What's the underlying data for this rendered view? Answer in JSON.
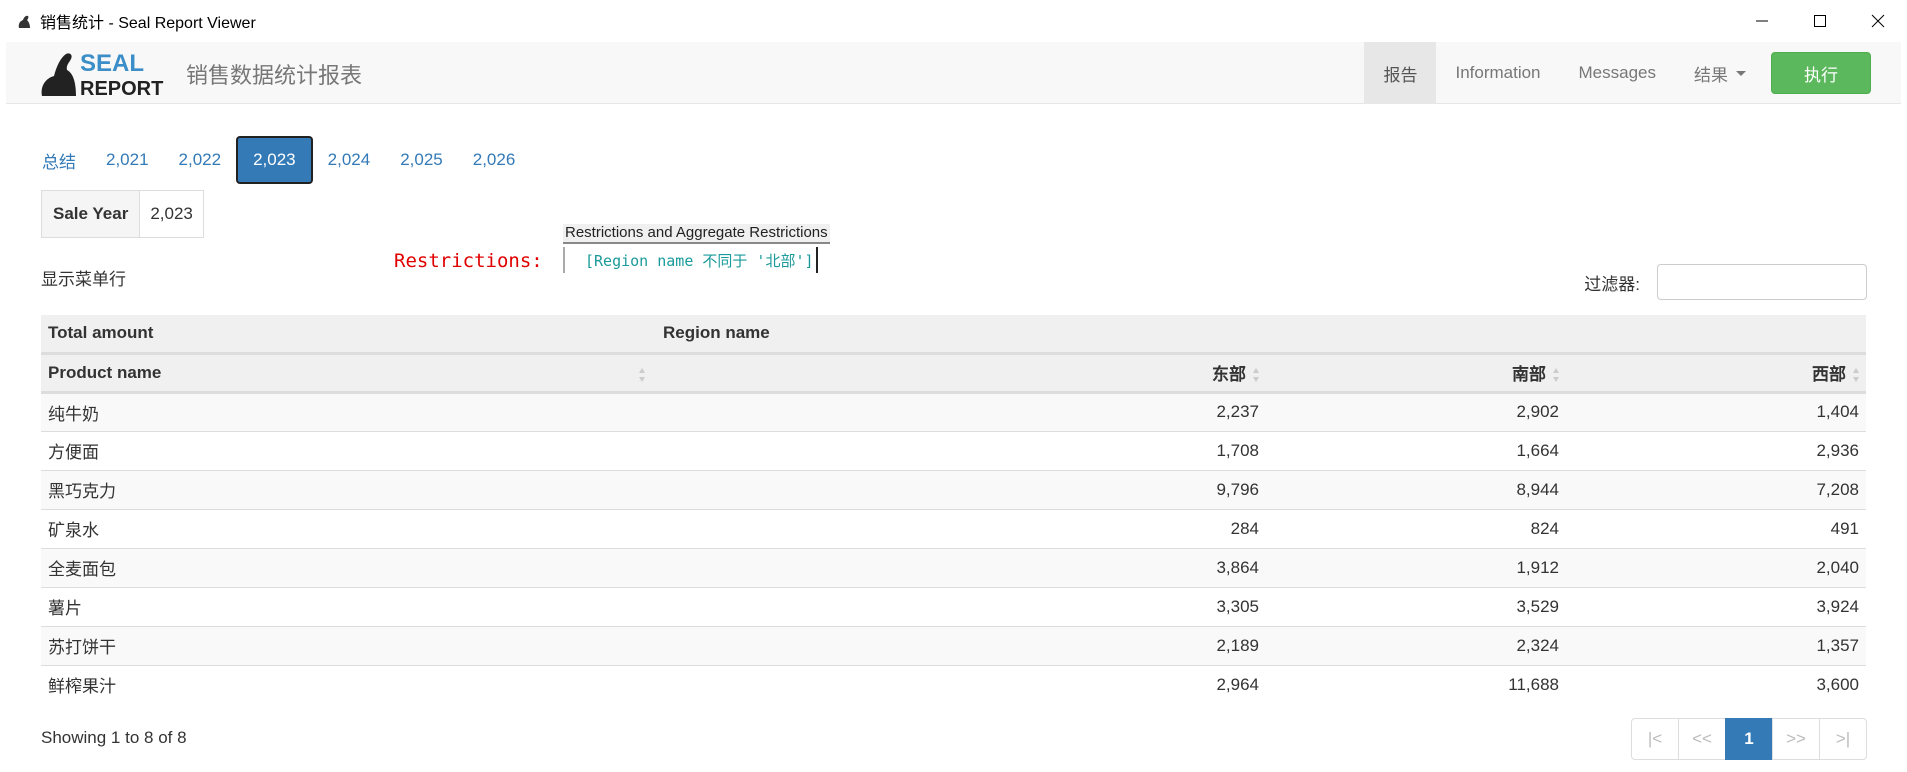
{
  "window": {
    "title": "销售统计 - Seal Report Viewer"
  },
  "navbar": {
    "brand_line1": "SEAL",
    "brand_line2": "REPORT",
    "report_title": "销售数据统计报表",
    "items": [
      {
        "label": "报告",
        "active": true
      },
      {
        "label": "Information"
      },
      {
        "label": "Messages"
      },
      {
        "label": "结果"
      }
    ],
    "run_label": "执行"
  },
  "tabs": [
    {
      "label": "总结"
    },
    {
      "label": "2,021"
    },
    {
      "label": "2,022"
    },
    {
      "label": "2,023",
      "active": true
    },
    {
      "label": "2,024"
    },
    {
      "label": "2,025"
    },
    {
      "label": "2,026"
    }
  ],
  "info": {
    "label": "Sale Year",
    "value": "2,023"
  },
  "restrictions": {
    "tooltip": "Restrictions and Aggregate Restrictions",
    "label": "Restrictions:",
    "value": "[Region name 不同于 '北部']"
  },
  "controls": {
    "show_menu": "显示菜单行",
    "filter_label": "过滤器:"
  },
  "table": {
    "header1": {
      "col1": "Total amount",
      "col2": "Region name"
    },
    "header2": {
      "product": "Product name",
      "east": "东部",
      "south": "南部",
      "west": "西部"
    },
    "rows": [
      {
        "product": "纯牛奶",
        "east": "2,237",
        "south": "2,902",
        "west": "1,404"
      },
      {
        "product": "方便面",
        "east": "1,708",
        "south": "1,664",
        "west": "2,936"
      },
      {
        "product": "黑巧克力",
        "east": "9,796",
        "south": "8,944",
        "west": "7,208"
      },
      {
        "product": "矿泉水",
        "east": "284",
        "south": "824",
        "west": "491"
      },
      {
        "product": "全麦面包",
        "east": "3,864",
        "south": "1,912",
        "west": "2,040"
      },
      {
        "product": "薯片",
        "east": "3,305",
        "south": "3,529",
        "west": "3,924"
      },
      {
        "product": "苏打饼干",
        "east": "2,189",
        "south": "2,324",
        "west": "1,357"
      },
      {
        "product": "鲜榨果汁",
        "east": "2,964",
        "south": "11,688",
        "west": "3,600"
      }
    ]
  },
  "footer": {
    "showing": "Showing 1 to 8 of 8",
    "pages": [
      "|<",
      "<<",
      "1",
      ">>",
      ">|"
    ]
  },
  "colors": {
    "link": "#337ab7",
    "run_button": "#5cb85c",
    "restriction_label": "#e00000",
    "restriction_value": "#1a9a9a"
  }
}
